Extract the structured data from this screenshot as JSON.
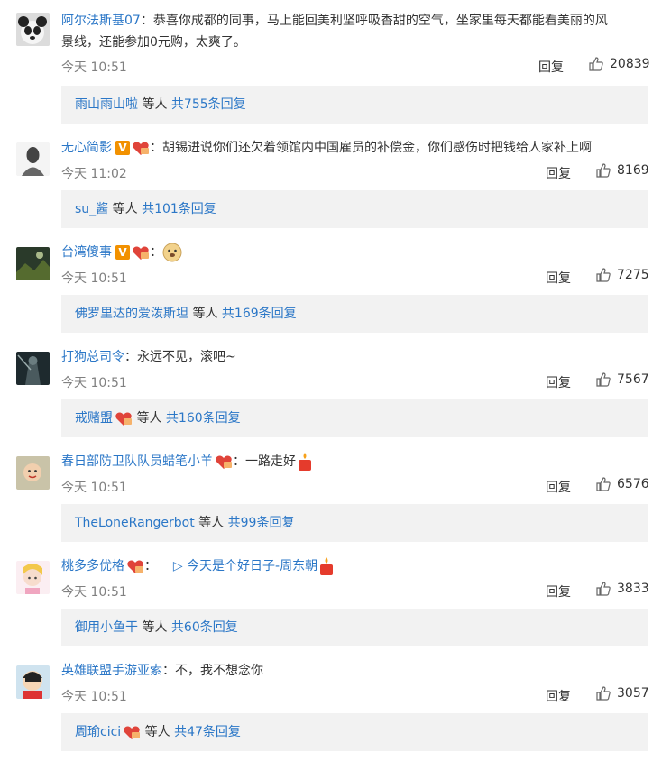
{
  "comments": [
    {
      "username": "阿尔法斯基07",
      "text_line1": "：恭喜你成都的同事，马上能回美利坚呼吸香甜的空气，坐家里每天都能看美丽的风",
      "text_line2": "景线，还能参加0元购，太爽了。",
      "time": "今天 10:51",
      "reply_label": "回复",
      "likes": "20839",
      "reply_user": "雨山雨山啦",
      "reply_mid": " 等人 ",
      "reply_total": "共755条回复",
      "avatar": "panda-avatar"
    },
    {
      "username": "无心简影",
      "text": "：胡锡进说你们还欠着领馆内中国雇员的补偿金，你们感伤时把钱给人家补上啊",
      "time": "今天 11:02",
      "reply_label": "回复",
      "likes": "8169",
      "reply_user": "su_酱",
      "reply_mid": " 等人 ",
      "reply_total": "共101条回复",
      "avatar": "grey-figure-avatar"
    },
    {
      "username": "台湾傻事",
      "text": "：",
      "time": "今天 10:51",
      "reply_label": "回复",
      "likes": "7275",
      "reply_user": "佛罗里达的爱泼斯坦",
      "reply_mid": " 等人 ",
      "reply_total": "共169条回复",
      "avatar": "dark-landscape-avatar"
    },
    {
      "username": "打狗总司令",
      "text": "：永远不见，滚吧~",
      "time": "今天 10:51",
      "reply_label": "回复",
      "likes": "7567",
      "reply_user": "戒赌盟",
      "reply_mid": " 等人 ",
      "reply_total": "共160条回复",
      "avatar": "armor-figure-avatar"
    },
    {
      "username": "春日部防卫队队员蜡笔小羊",
      "text": "：一路走好",
      "time": "今天 10:51",
      "reply_label": "回复",
      "likes": "6576",
      "reply_user": "TheLoneRangerbot",
      "reply_mid": " 等人 ",
      "reply_total": "共99条回复",
      "avatar": "baby-avatar"
    },
    {
      "username": "桃多多优格",
      "text": "：",
      "link": "▷ 今天是个好日子-周东朝",
      "time": "今天 10:51",
      "reply_label": "回复",
      "likes": "3833",
      "reply_user": "御用小鱼干",
      "reply_mid": " 等人 ",
      "reply_total": "共60条回复",
      "avatar": "anime-girl-avatar"
    },
    {
      "username": "英雄联盟手游亚索",
      "text": "：不，我不想念你",
      "time": "今天 10:51",
      "reply_label": "回复",
      "likes": "3057",
      "reply_user": "周瑜cici",
      "reply_mid": " 等人 ",
      "reply_total": "共47条回复",
      "avatar": "cartoon-boy-avatar"
    }
  ],
  "colors": {
    "link": "#2b77c7",
    "meta": "#808080",
    "reply_bg": "#f2f2f2",
    "vip": "#f29100",
    "heart": "#e0443a"
  }
}
